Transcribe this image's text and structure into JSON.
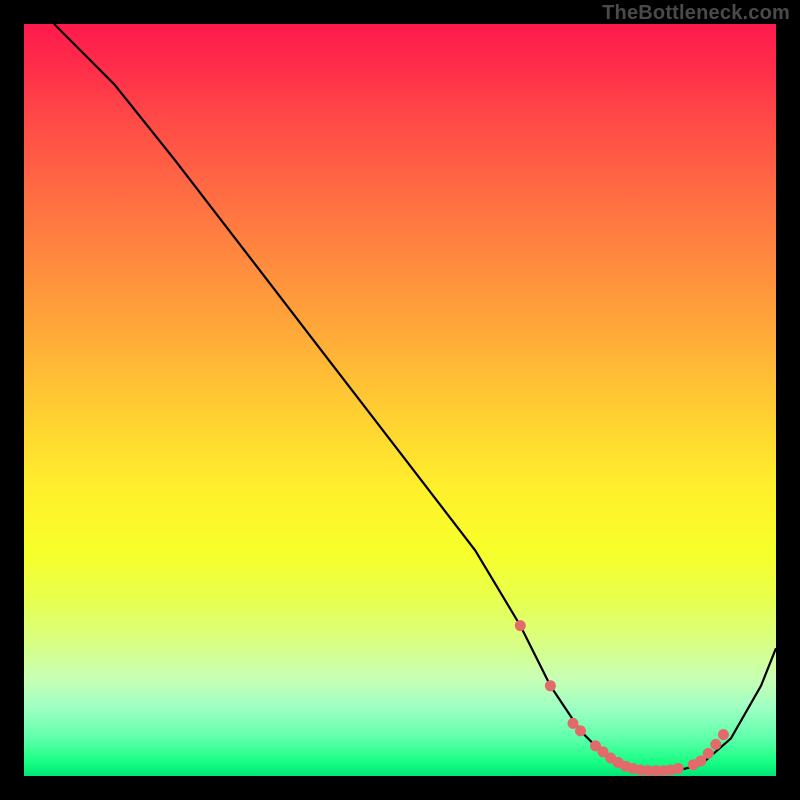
{
  "watermark": "TheBottleneck.com",
  "chart_data": {
    "type": "line",
    "title": "",
    "xlabel": "",
    "ylabel": "",
    "xlim": [
      0,
      100
    ],
    "ylim": [
      0,
      100
    ],
    "series": [
      {
        "name": "curve",
        "x": [
          4,
          8,
          12,
          20,
          30,
          40,
          50,
          60,
          66,
          70,
          74,
          78,
          82,
          86,
          90,
          94,
          98,
          100
        ],
        "y": [
          100,
          96,
          92,
          82,
          69,
          56,
          43,
          30,
          20,
          12,
          6,
          2,
          0.5,
          0.5,
          1.5,
          5,
          12,
          17
        ]
      }
    ],
    "markers": {
      "name": "highlight-dots",
      "x": [
        66,
        70,
        73,
        74,
        76,
        77,
        78,
        79,
        80,
        81,
        82,
        83,
        84,
        85,
        86,
        87,
        89,
        90,
        91,
        92,
        93
      ],
      "y": [
        20,
        12,
        7,
        6,
        4,
        3.2,
        2.4,
        1.8,
        1.3,
        1.0,
        0.8,
        0.7,
        0.7,
        0.7,
        0.8,
        1.0,
        1.5,
        2.0,
        3.0,
        4.2,
        5.5
      ]
    },
    "colors": {
      "gradient_top": "#ff1a4d",
      "gradient_mid": "#ffd032",
      "gradient_bottom": "#00e676",
      "curve": "#000000",
      "marker": "#e36a6a",
      "frame_bg": "#000000",
      "watermark": "#4a4a4a"
    }
  }
}
